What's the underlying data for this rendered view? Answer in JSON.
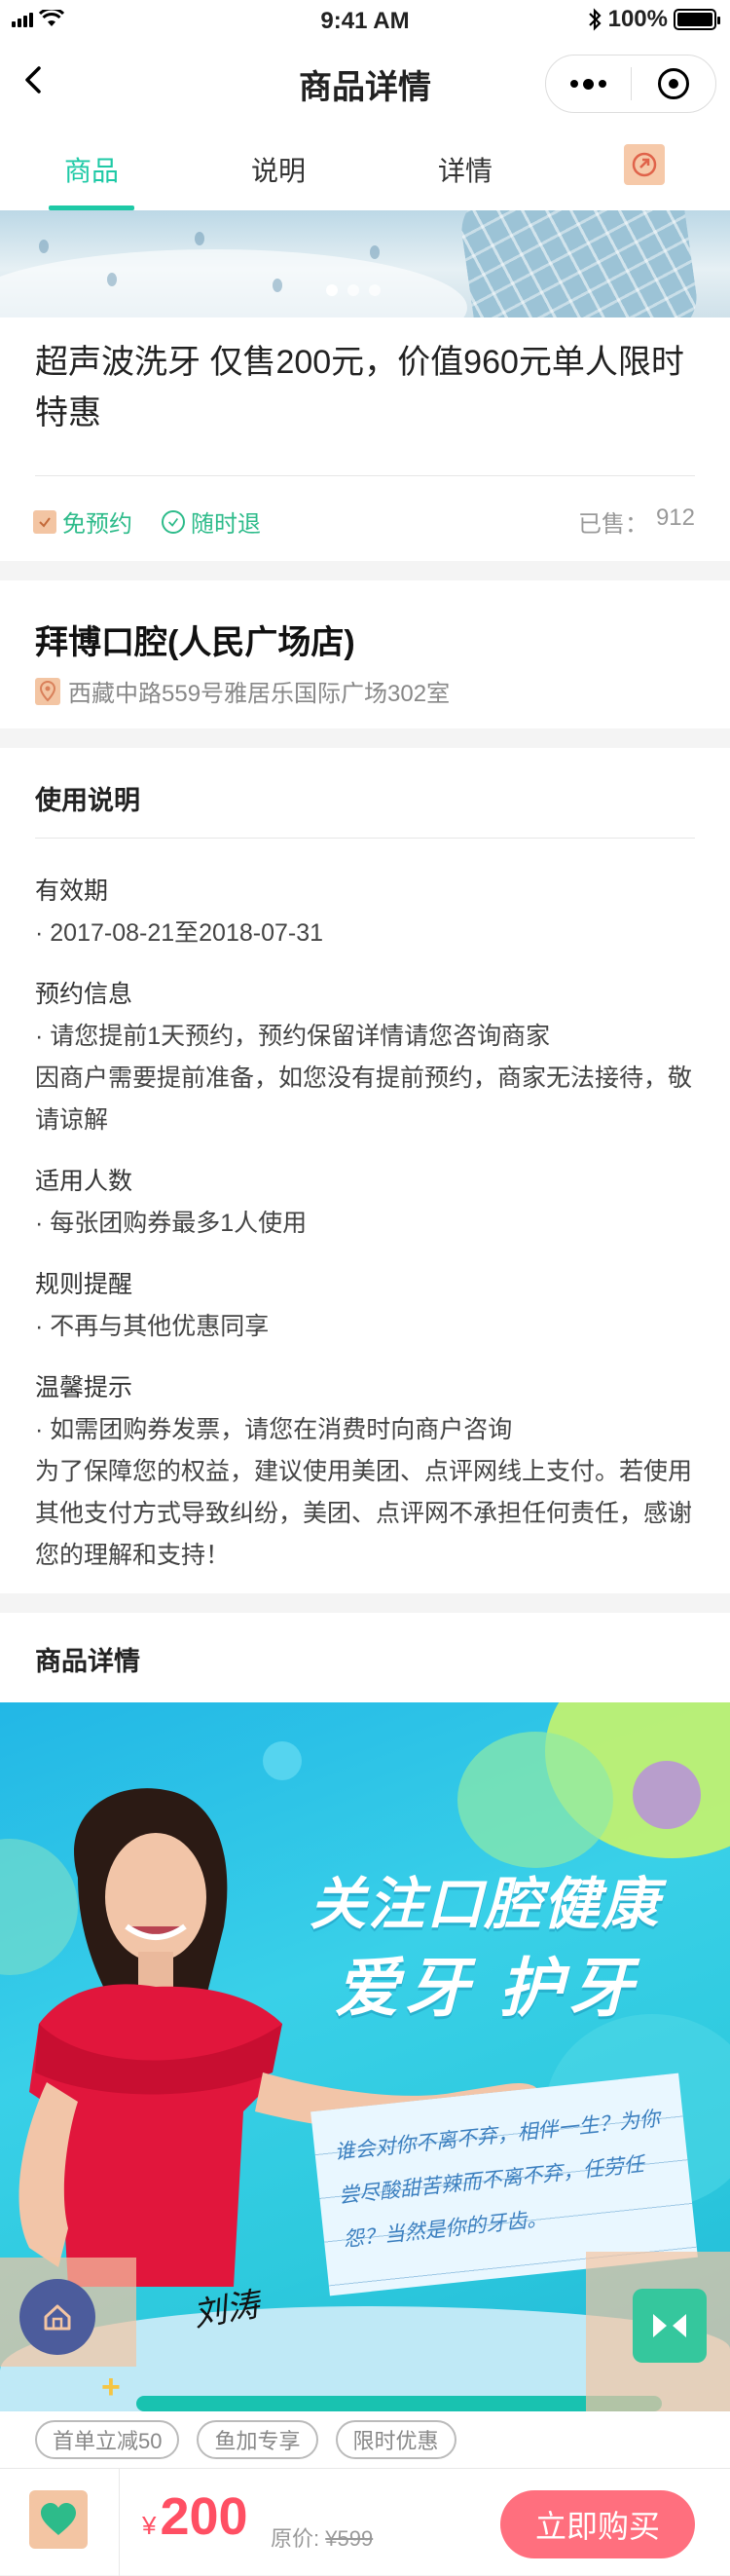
{
  "status_bar": {
    "time": "9:41 AM",
    "battery": "100%"
  },
  "nav": {
    "title": "商品详情"
  },
  "tabs": [
    {
      "label": "商品",
      "active": true
    },
    {
      "label": "说明",
      "active": false
    },
    {
      "label": "详情",
      "active": false
    }
  ],
  "banner": {
    "slide_count": 3,
    "active_slide": 1
  },
  "product": {
    "title": "超声波洗牙 仅售200元，价值960元单人限时特惠",
    "tags": [
      "免预约",
      "随时退"
    ],
    "sold_label": "已售：",
    "sold_count": "912"
  },
  "store": {
    "name": "拜博口腔(人民广场店)",
    "address": "西藏中路559号雅居乐国际广场302室"
  },
  "usage": {
    "title": "使用说明",
    "items": [
      {
        "heading": "有效期",
        "lines": [
          "· 2017-08-21至2018-07-31"
        ]
      },
      {
        "heading": "预约信息",
        "lines": [
          "· 请您提前1天预约，预约保留详情请您咨询商家",
          "因商户需要提前准备，如您没有提前预约，商家无法接待，敬请谅解"
        ]
      },
      {
        "heading": "适用人数",
        "lines": [
          "· 每张团购券最多1人使用"
        ]
      },
      {
        "heading": "规则提醒",
        "lines": [
          "· 不再与其他优惠同享"
        ]
      },
      {
        "heading": "温馨提示",
        "lines": [
          "· 如需团购券发票，请您在消费时向商户咨询",
          "为了保障您的权益，建议使用美团、点评网线上支付。若使用其他支付方式导致纠纷，美团、点评网不承担任何责任，感谢您的理解和支持！"
        ]
      }
    ]
  },
  "detail": {
    "title": "商品详情",
    "poster": {
      "headline_1": "关注口腔健康",
      "headline_2": "爱牙 护牙",
      "note": "谁会对你不离不弃，相伴一生？为你尝尽酸甜苦辣而不离不弃，任劳任怨？当然是你的牙齿。",
      "signature": "刘涛"
    }
  },
  "coupons": [
    "首单立减50",
    "鱼加专享",
    "限时优惠"
  ],
  "bottom_bar": {
    "currency": "¥",
    "price": "200",
    "original_label": "原价:",
    "original_price": "¥599",
    "buy_label": "立即购买"
  },
  "colors": {
    "accent": "#1ec9a6",
    "price": "#ff4f63",
    "buy_button": "#ff6f7e"
  }
}
